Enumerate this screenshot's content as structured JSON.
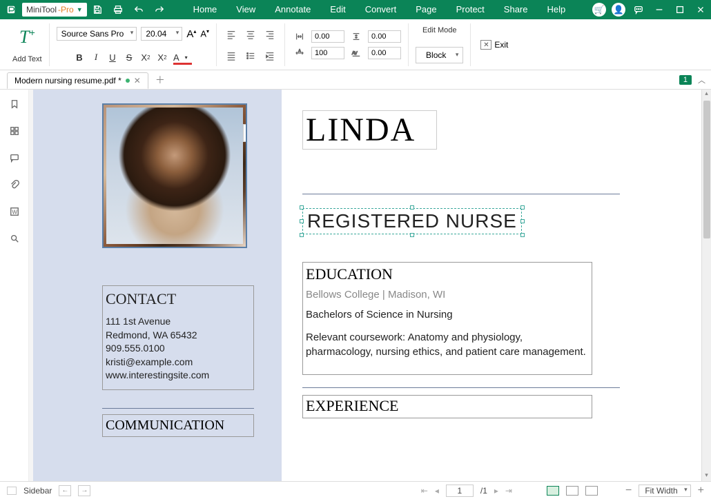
{
  "app": {
    "name_main": "MiniTool",
    "name_suffix": "-Pro"
  },
  "menus": [
    "Home",
    "View",
    "Annotate",
    "Edit",
    "Convert",
    "Page",
    "Protect",
    "Share",
    "Help"
  ],
  "ribbon": {
    "add_text": "Add Text",
    "font_family": "Source Sans Pro",
    "font_size": "20.04",
    "spacing": {
      "a": "0.00",
      "b": "0.00",
      "c": "100",
      "d": "0.00"
    },
    "edit_mode_label": "Edit Mode",
    "block_label": "Block",
    "exit_label": "Exit"
  },
  "tab": {
    "filename": "Modern nursing resume.pdf *",
    "page_indicator": "1"
  },
  "doc": {
    "name_title": "LINDA",
    "role_title": "REGISTERED NURSE",
    "contact": {
      "heading": "CONTACT",
      "line1": "111 1st Avenue",
      "line2": "Redmond, WA 65432",
      "line3": "909.555.0100",
      "line4": "kristi@example.com",
      "line5": "www.interestingsite.com"
    },
    "communication_heading": "COMMUNICATION",
    "education": {
      "heading": "EDUCATION",
      "school": "Bellows College | Madison, WI",
      "degree": "Bachelors of Science in Nursing",
      "coursework": "Relevant coursework: Anatomy and physiology, pharmacology, nursing ethics, and patient care management."
    },
    "experience_heading": "EXPERIENCE"
  },
  "status": {
    "sidebar_label": "Sidebar",
    "page_current": "1",
    "page_total": "/1",
    "fit_label": "Fit Width"
  }
}
